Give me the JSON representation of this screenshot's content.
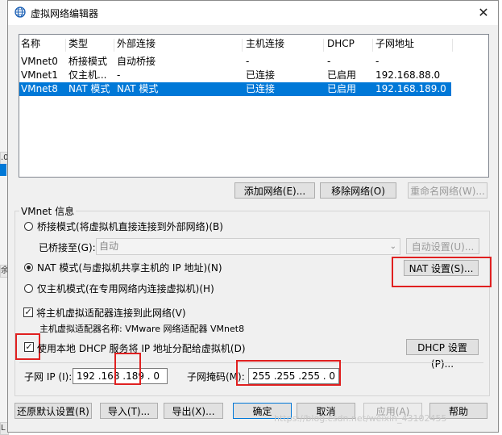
{
  "background": {
    "tabs": [
      ".0",
      "余",
      "L"
    ]
  },
  "window": {
    "title": "虚拟网络编辑器",
    "close": "✕"
  },
  "network_list": {
    "columns": [
      "名称",
      "类型",
      "外部连接",
      "主机连接",
      "DHCP",
      "子网地址"
    ],
    "rows": [
      {
        "name": "VMnet0",
        "type": "桥接模式",
        "external": "自动桥接",
        "host": "-",
        "dhcp": "-",
        "subnet": "-"
      },
      {
        "name": "VMnet1",
        "type": "仅主机...",
        "external": "-",
        "host": "已连接",
        "dhcp": "已启用",
        "subnet": "192.168.88.0"
      },
      {
        "name": "VMnet8",
        "type": "NAT 模式",
        "external": "NAT 模式",
        "host": "已连接",
        "dhcp": "已启用",
        "subnet": "192.168.189.0"
      }
    ],
    "selected_index": 2
  },
  "list_buttons": {
    "add": "添加网络(E)...",
    "remove": "移除网络(O)",
    "rename": "重命名网络(W)..."
  },
  "vmnet_info": {
    "group_title": "VMnet 信息",
    "bridged_label": "桥接模式(将虚拟机直接连接到外部网络)(B)",
    "bridged_to_label": "已桥接至(G):",
    "bridged_to_value": "自动",
    "auto_settings": "自动设置(U)...",
    "nat_label": "NAT 模式(与虚拟机共享主机的 IP 地址)(N)",
    "nat_settings": "NAT 设置(S)...",
    "hostonly_label": "仅主机模式(在专用网络内连接虚拟机)(H)",
    "selected_mode": "nat",
    "connect_adapter_label": "将主机虚拟适配器连接到此网络(V)",
    "connect_adapter_checked": true,
    "adapter_name_label": "主机虚拟适配器名称: VMware 网络适配器 VMnet8",
    "dhcp_label": "使用本地 DHCP 服务将 IP 地址分配给虚拟机(D)",
    "dhcp_checked": true,
    "dhcp_settings": "DHCP 设置(P)...",
    "subnet_ip_label": "子网 IP (I):",
    "subnet_ip_value": "192 .168 .189 . 0",
    "subnet_mask_label": "子网掩码(M):",
    "subnet_mask_value": "255 .255 .255 . 0"
  },
  "footer_buttons": {
    "restore": "还原默认设置(R)",
    "import": "导入(T)...",
    "export": "导出(X)...",
    "ok": "确定",
    "cancel": "取消",
    "apply": "应用(A)",
    "help": "帮助"
  },
  "watermark": "https://blog.csdn.net/weixin_43102455",
  "colors": {
    "selection": "#0078d7",
    "highlight_box": "#e02020"
  }
}
